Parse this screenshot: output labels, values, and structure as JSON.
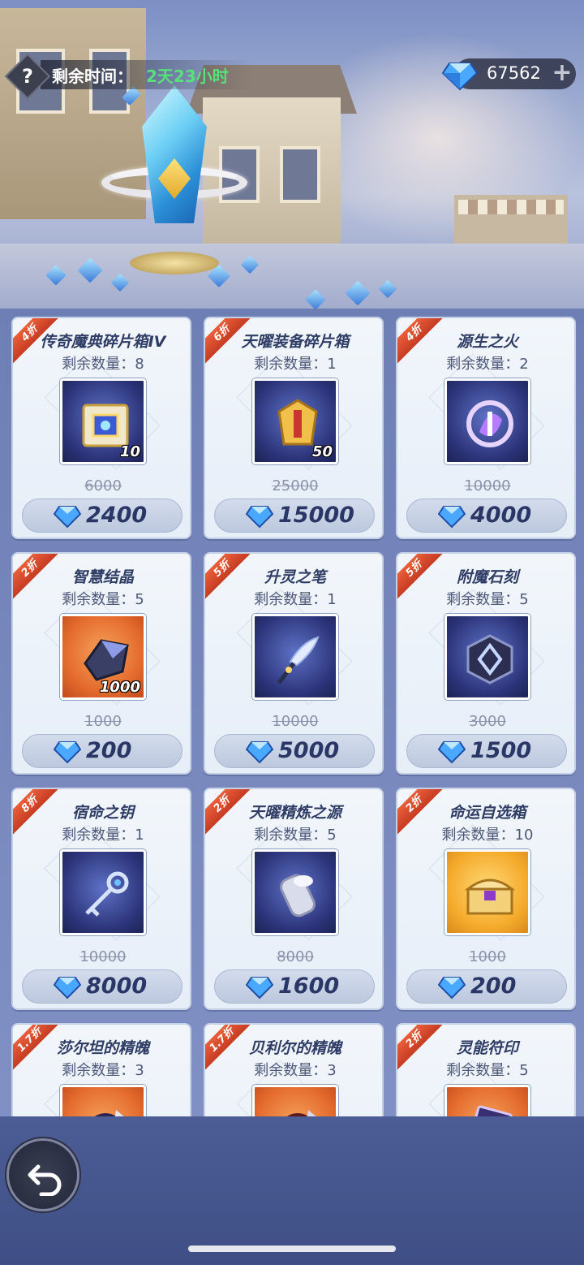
{
  "header": {
    "help_icon": "question-mark-icon",
    "time_label": "剩余时间：",
    "time_value": "2天23小时",
    "currency_icon": "diamond-icon",
    "currency_value": "67562",
    "add_icon": "plus-icon"
  },
  "colors": {
    "timer_green": "#58e07c",
    "discount_red": "#d84a2c",
    "price_text": "#2a3766"
  },
  "items": [
    {
      "tag": "4折",
      "name": "传奇魔典碎片箱IV",
      "stock": "剩余数量：8",
      "qty": "10",
      "old_price": "6000",
      "price": "2400",
      "icon": "cube-chest-icon",
      "bg": "blue"
    },
    {
      "tag": "6折",
      "name": "天曜装备碎片箱",
      "stock": "剩余数量：1",
      "qty": "50",
      "old_price": "25000",
      "price": "15000",
      "icon": "golden-armor-icon",
      "bg": "blue"
    },
    {
      "tag": "4折",
      "name": "源生之火",
      "stock": "剩余数量：2",
      "qty": "",
      "old_price": "10000",
      "price": "4000",
      "icon": "spiral-flame-icon",
      "bg": "blue"
    },
    {
      "tag": "2折",
      "name": "智慧结晶",
      "stock": "剩余数量：5",
      "qty": "1000",
      "old_price": "1000",
      "price": "200",
      "icon": "dark-crystal-icon",
      "bg": "orange"
    },
    {
      "tag": "5折",
      "name": "升灵之笔",
      "stock": "剩余数量：1",
      "qty": "",
      "old_price": "10000",
      "price": "5000",
      "icon": "feather-quill-icon",
      "bg": "blue"
    },
    {
      "tag": "5折",
      "name": "附魔石刻",
      "stock": "剩余数量：5",
      "qty": "",
      "old_price": "3000",
      "price": "1500",
      "icon": "rune-stone-icon",
      "bg": "blue"
    },
    {
      "tag": "8折",
      "name": "宿命之钥",
      "stock": "剩余数量：1",
      "qty": "",
      "old_price": "10000",
      "price": "8000",
      "icon": "key-icon",
      "bg": "blue"
    },
    {
      "tag": "2折",
      "name": "天曜精炼之源",
      "stock": "剩余数量：5",
      "qty": "",
      "old_price": "8000",
      "price": "1600",
      "icon": "silver-cylinder-icon",
      "bg": "blue"
    },
    {
      "tag": "2折",
      "name": "命运自选箱",
      "stock": "剩余数量：10",
      "qty": "",
      "old_price": "1000",
      "price": "200",
      "icon": "treasure-chest-icon",
      "bg": "gold"
    },
    {
      "tag": "1.7折",
      "name": "莎尔坦的精魄",
      "stock": "剩余数量：3",
      "qty": "",
      "old_price": "",
      "price": "",
      "icon": "dark-orb-icon",
      "bg": "orange"
    },
    {
      "tag": "1.7折",
      "name": "贝利尔的精魄",
      "stock": "剩余数量：3",
      "qty": "",
      "old_price": "",
      "price": "",
      "icon": "red-orb-icon",
      "bg": "orange"
    },
    {
      "tag": "2折",
      "name": "灵能符印",
      "stock": "剩余数量：5",
      "qty": "",
      "old_price": "",
      "price": "",
      "icon": "rune-card-icon",
      "bg": "orange"
    }
  ],
  "footer": {
    "back_icon": "return-arrow-icon"
  }
}
